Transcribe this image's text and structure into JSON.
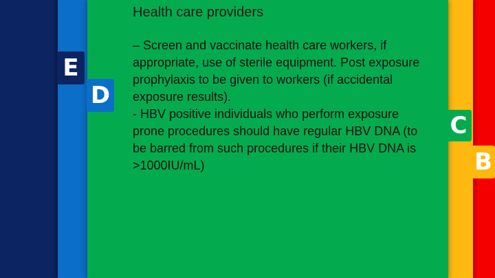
{
  "slide": {
    "title": "Health care providers",
    "paragraphs": [
      "– Screen and vaccinate health care workers, if appropriate, use of sterile equipment. Post exposure prophylaxis to be given to workers (if accidental exposure results).",
      "- HBV positive individuals who perform exposure prone procedures should have regular HBV DNA (to be barred from such procedures if their HBV DNA is >1000IU/mL)"
    ]
  },
  "tabs": {
    "e": "E",
    "d": "D",
    "c": "C",
    "b": "B"
  },
  "colors": {
    "navy": "#0c2461",
    "blue": "#0b6fc9",
    "green": "#04ab4e",
    "yellow": "#fdb90f",
    "red": "#f40000"
  }
}
